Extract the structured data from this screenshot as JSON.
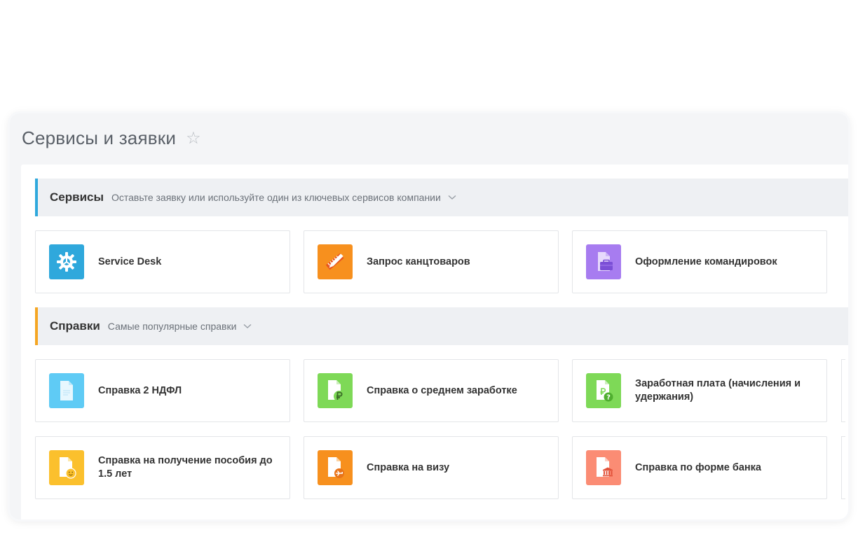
{
  "page": {
    "title": "Сервисы и заявки"
  },
  "sections": [
    {
      "title": "Сервисы",
      "description": "Оставьте заявку или используйте один из ключевых сервисов компании",
      "accent": "#2fa8dc",
      "items": [
        {
          "label": "Service Desk",
          "icon": "gear-icon",
          "color": "#2fa8dc"
        },
        {
          "label": "Запрос канцтоваров",
          "icon": "pencil-ruler-icon",
          "color": "#f7901e"
        },
        {
          "label": "Оформление командировок",
          "icon": "briefcase-document-icon",
          "color": "#a77cf0"
        }
      ]
    },
    {
      "title": "Справки",
      "description": "Самые популярные справки",
      "accent": "#f5a623",
      "items": [
        {
          "label": "Справка 2 НДФЛ",
          "icon": "document-icon",
          "color": "#5fcbf5"
        },
        {
          "label": "Справка о среднем заработке",
          "icon": "ruble-document-icon",
          "color": "#7ed957"
        },
        {
          "label": "Заработная плата (начисления и удержания)",
          "icon": "salary-question-icon",
          "color": "#7ed957"
        },
        {
          "label": "Справка на получение пособия до 1.5 лет",
          "icon": "baby-document-icon",
          "color": "#fbc02d"
        },
        {
          "label": "Справка на визу",
          "icon": "plane-document-icon",
          "color": "#f7901e"
        },
        {
          "label": "Справка по форме банка",
          "icon": "bank-document-icon",
          "color": "#fb8c74"
        }
      ]
    }
  ]
}
